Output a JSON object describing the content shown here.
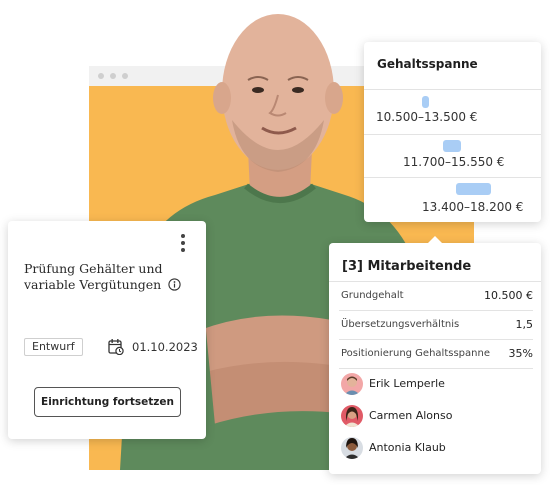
{
  "salary_card": {
    "title": "Gehaltsspanne",
    "ranges": [
      {
        "label": "10.500–13.500 €"
      },
      {
        "label": "11.700–15.550 €"
      },
      {
        "label": "13.400–18.200 €"
      }
    ]
  },
  "review_card": {
    "title": "Prüfung Gehälter und variable Vergütungen",
    "info_icon": "info-icon",
    "menu_icon": "kebab-menu-icon",
    "status_badge": "Entwurf",
    "calendar_icon": "calendar-icon",
    "date": "01.10.2023",
    "continue_button": "Einrichtung fortsetzen"
  },
  "employee_card": {
    "title": "[3] Mitarbeitende",
    "rows": [
      {
        "label": "Grundgehalt",
        "value": "10.500 €"
      },
      {
        "label": "Übersetzungsverhältnis",
        "value": "1,5"
      },
      {
        "label": "Positionierung Gehaltsspanne",
        "value": "35%"
      }
    ],
    "people": [
      {
        "name": "Erik Lemperle"
      },
      {
        "name": "Carmen Alonso"
      },
      {
        "name": "Antonia Klaub"
      }
    ]
  },
  "colors": {
    "background_panel": "#f9b851",
    "range_bar": "#a9cdf5",
    "shirt": "#5e8a5c"
  }
}
